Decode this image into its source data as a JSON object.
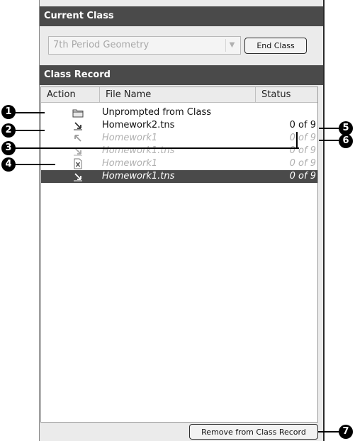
{
  "current_class": {
    "header": "Current Class",
    "select_value": "7th Period Geometry",
    "end_button": "End Class"
  },
  "class_record": {
    "header": "Class Record",
    "columns": [
      "Action",
      "File Name",
      "Status"
    ],
    "rows": [
      {
        "icon": "folder-icon",
        "file": "Unprompted from Class",
        "status": "",
        "state": "active"
      },
      {
        "icon": "collect-arrow-icon",
        "file": "Homework2.tns",
        "status": "0 of 9",
        "state": "active"
      },
      {
        "icon": "send-arrow-icon",
        "file": "Homework1",
        "status": "0 of 9",
        "state": "dim"
      },
      {
        "icon": "collect-arrow-icon",
        "file": "Homework1.tns",
        "status": "0 of 9",
        "state": "dim"
      },
      {
        "icon": "delete-file-icon",
        "file": "Homework1",
        "status": "0 of 9",
        "state": "dim"
      },
      {
        "icon": "collect-arrow-icon",
        "file": "Homework1.tns",
        "status": "0 of 9",
        "state": "selected"
      }
    ],
    "remove_button": "Remove from Class Record"
  },
  "callouts": [
    "1",
    "2",
    "3",
    "4",
    "5",
    "6",
    "7"
  ]
}
